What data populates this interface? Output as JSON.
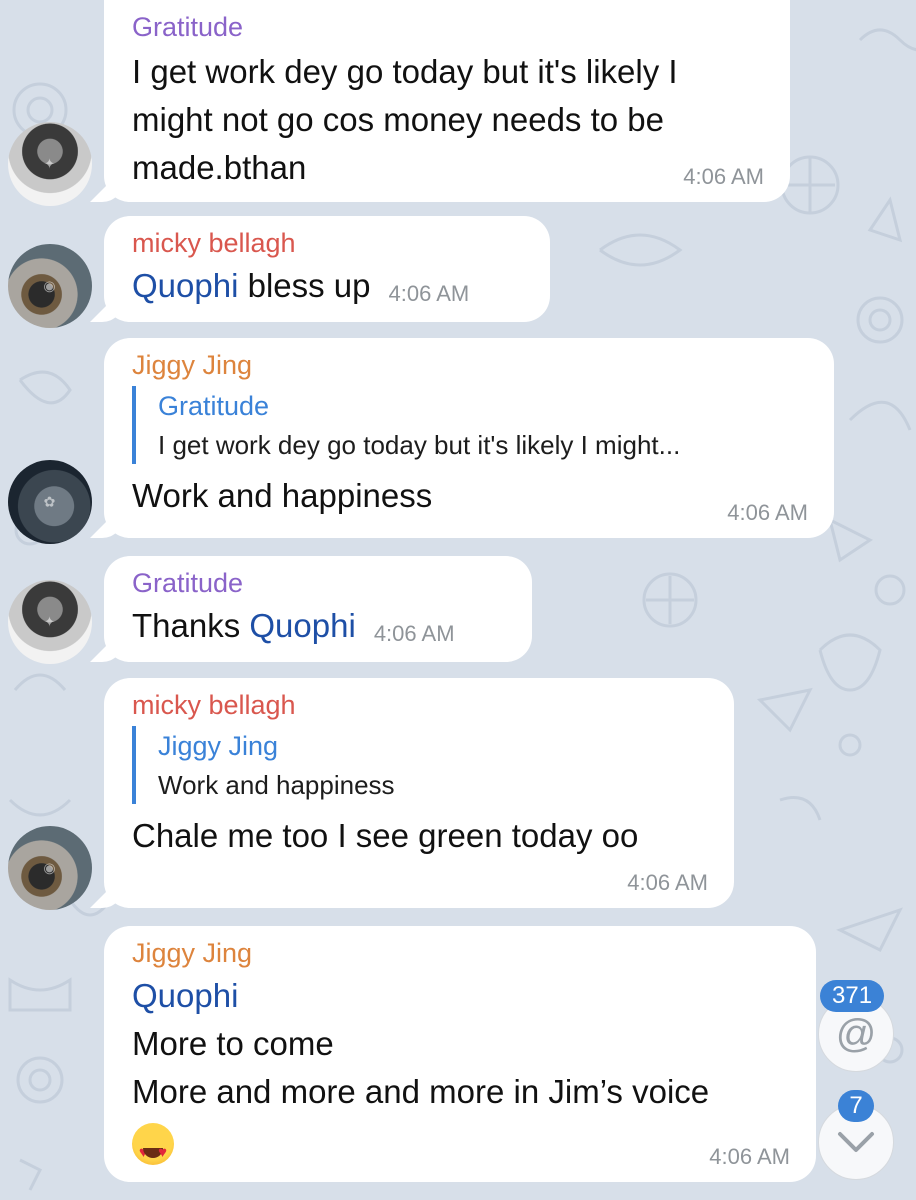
{
  "messages": [
    {
      "sender": "Gratitude",
      "text_lines": [
        "I get work dey go today but it's likely I",
        "might not go cos money needs to be",
        "made.bthan"
      ],
      "time": "4:06 AM"
    },
    {
      "sender": "micky bellagh",
      "mention": "Quophi",
      "text": " bless up",
      "time": "4:06 AM"
    },
    {
      "sender": "Jiggy Jing",
      "reply_to": {
        "name": "Gratitude",
        "text": "I get work dey go today but it's likely I might..."
      },
      "text": "Work and happiness",
      "time": "4:06 AM"
    },
    {
      "sender": "Gratitude",
      "text": "Thanks ",
      "mention": "Quophi",
      "time": "4:06 AM"
    },
    {
      "sender": "micky bellagh",
      "reply_to": {
        "name": "Jiggy Jing",
        "text": "Work and happiness"
      },
      "text": "Chale me too I see green today oo",
      "time": "4:06 AM"
    },
    {
      "sender": "Jiggy Jing",
      "mention": "Quophi",
      "text_lines": [
        "More to come",
        "More and more and more in Jim’s voice"
      ],
      "emoji": "heart-eyes-emoji",
      "time": "4:06 AM"
    }
  ],
  "mentions_button": {
    "badge": "371",
    "icon": "@"
  },
  "scroll_down_button": {
    "badge": "7",
    "icon": "chevron-down-icon"
  },
  "colors": {
    "background": "#d7dfe9",
    "gratitude_name": "#8a63c9",
    "micky_name": "#d9574e",
    "jiggy_name": "#dd843d",
    "reply_accent": "#3a82d8",
    "mention": "#1e4fa6",
    "badge": "#3b82d6"
  }
}
